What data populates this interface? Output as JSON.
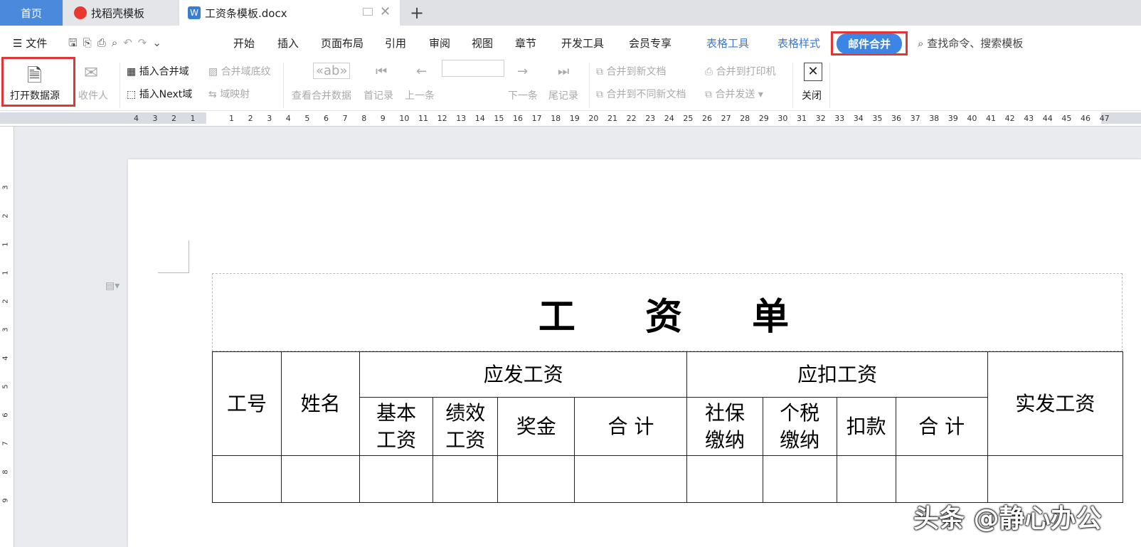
{
  "tabs": {
    "home": "首页",
    "daoke": "找稻壳模板",
    "doc": "工资条模板.docx"
  },
  "menu": {
    "file": "文件",
    "items": [
      "开始",
      "插入",
      "页面布局",
      "引用",
      "审阅",
      "视图",
      "章节",
      "开发工具",
      "会员专享"
    ],
    "table_tools": "表格工具",
    "table_style": "表格样式",
    "mail_merge": "邮件合并",
    "search_placeholder": "查找命令、搜索模板"
  },
  "ribbon": {
    "open_source": "打开数据源",
    "recipients": "收件人",
    "insert_field": "插入合并域",
    "insert_next": "插入Next域",
    "field_shading": "合并域底纹",
    "field_mapping": "域映射",
    "view_data": "查看合并数据",
    "first_record": "首记录",
    "prev": "上一条",
    "next": "下一条",
    "last_record": "尾记录",
    "merge_new_doc": "合并到新文档",
    "merge_diff_docs": "合并到不同新文档",
    "merge_printer": "合并到打印机",
    "merge_send": "合并发送",
    "close": "关闭"
  },
  "ruler": {
    "left_ticks": [
      "4",
      "3",
      "2",
      "1"
    ],
    "right_ticks": [
      "1",
      "2",
      "3",
      "4",
      "5",
      "6",
      "7",
      "8",
      "9",
      "10",
      "11",
      "12",
      "13",
      "14",
      "15",
      "16",
      "17",
      "18",
      "19",
      "20",
      "21",
      "22",
      "23",
      "24",
      "25",
      "26",
      "27",
      "28",
      "29",
      "30",
      "31",
      "32",
      "33",
      "34",
      "35",
      "36",
      "37",
      "38",
      "39",
      "40",
      "41",
      "42",
      "43",
      "44",
      "45",
      "46",
      "47"
    ],
    "vertical_ticks": [
      "3",
      "2",
      "1",
      "1",
      "2",
      "3",
      "4",
      "5",
      "6",
      "7",
      "8",
      "9"
    ]
  },
  "document": {
    "title": "工 资 单",
    "headers": {
      "id": "工号",
      "name": "姓名",
      "payable": "应发工资",
      "deduct": "应扣工资",
      "actual": "实发工资",
      "basic": "基本\n工资",
      "perf": "绩效\n工资",
      "bonus": "奖金",
      "sum1": "合 计",
      "social": "社保\n缴纳",
      "tax": "个税\n缴纳",
      "deduction": "扣款",
      "sum2": "合 计"
    }
  },
  "watermark": "头条 @静心办公"
}
